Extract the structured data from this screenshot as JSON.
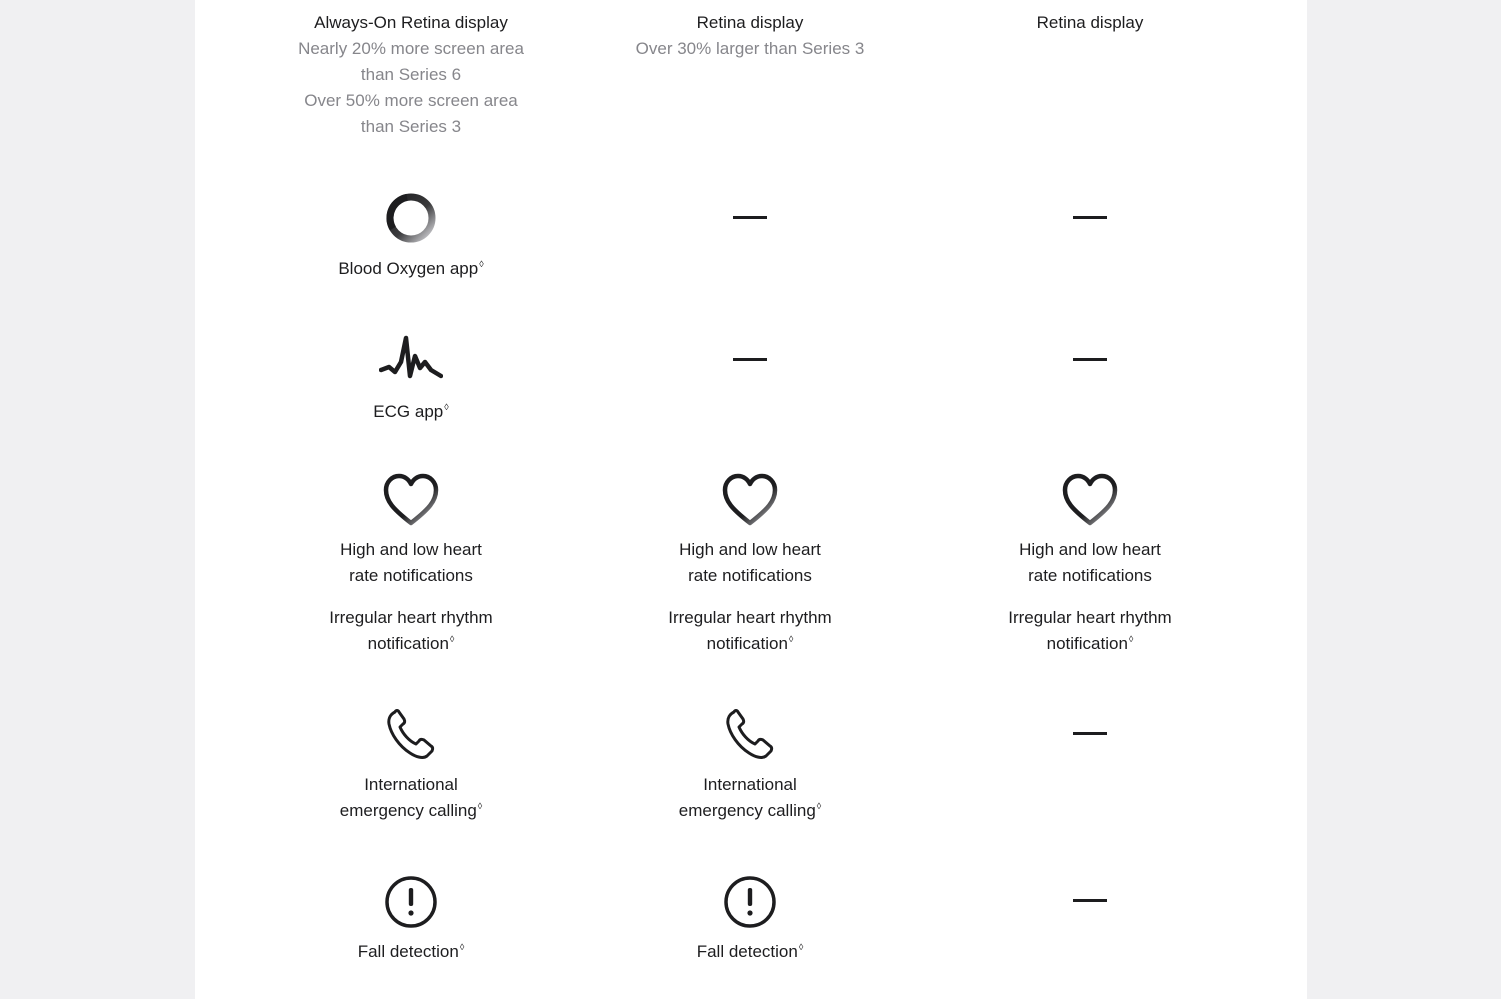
{
  "columns": [
    {
      "display": {
        "title": "Always-On Retina display",
        "notes": [
          "Nearly 20% more screen area than Series 6",
          "Over 50% more screen area than Series 3"
        ]
      },
      "blood_oxygen": {
        "available": true,
        "label": "Blood Oxygen app",
        "mark": "◊",
        "icon": "blood-oxygen-ring-icon"
      },
      "ecg": {
        "available": true,
        "label": "ECG app",
        "mark": "◊",
        "icon": "ecg-waveform-icon"
      },
      "heart": {
        "available": true,
        "label1": "High and low heart rate notifications",
        "label2": "Irregular heart rhythm notification",
        "mark": "◊",
        "icon": "heart-icon"
      },
      "calling": {
        "available": true,
        "label": "International emergency calling",
        "mark": "◊",
        "icon": "phone-icon"
      },
      "fall": {
        "available": true,
        "label": "Fall detection",
        "mark": "◊",
        "icon": "exclamation-circle-icon"
      }
    },
    {
      "display": {
        "title": "Retina display",
        "notes": [
          "Over 30% larger than Series 3"
        ]
      },
      "blood_oxygen": {
        "available": false
      },
      "ecg": {
        "available": false
      },
      "heart": {
        "available": true,
        "label1": "High and low heart rate notifications",
        "label2": "Irregular heart rhythm notification",
        "mark": "◊",
        "icon": "heart-icon"
      },
      "calling": {
        "available": true,
        "label": "International emergency calling",
        "mark": "◊",
        "icon": "phone-icon"
      },
      "fall": {
        "available": true,
        "label": "Fall detection",
        "mark": "◊",
        "icon": "exclamation-circle-icon"
      }
    },
    {
      "display": {
        "title": "Retina display",
        "notes": []
      },
      "blood_oxygen": {
        "available": false
      },
      "ecg": {
        "available": false
      },
      "heart": {
        "available": true,
        "label1": "High and low heart rate notifications",
        "label2": "Irregular heart rhythm notification",
        "mark": "◊",
        "icon": "heart-icon"
      },
      "calling": {
        "available": false
      },
      "fall": {
        "available": false
      }
    }
  ],
  "colors": {
    "page_background": "#f0f0f2",
    "panel_background": "#ffffff",
    "text_primary": "#1d1d1f",
    "text_secondary": "#86868b"
  }
}
